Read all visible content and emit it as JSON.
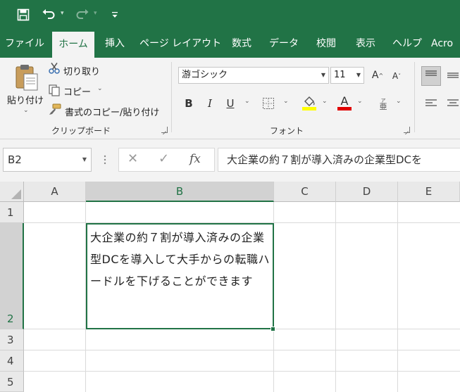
{
  "qat": {
    "save_icon": "save-icon",
    "undo_icon": "undo-icon",
    "redo_icon": "redo-icon",
    "customize_icon": "customize-qat-icon"
  },
  "tabs": [
    {
      "label": "ファイル"
    },
    {
      "label": "ホーム"
    },
    {
      "label": "挿入"
    },
    {
      "label": "ページ レイアウト"
    },
    {
      "label": "数式"
    },
    {
      "label": "データ"
    },
    {
      "label": "校閲"
    },
    {
      "label": "表示"
    },
    {
      "label": "ヘルプ"
    },
    {
      "label": "Acro"
    }
  ],
  "active_tab": "ホーム",
  "clipboard": {
    "paste_label": "貼り付け",
    "cut_label": "切り取り",
    "copy_label": "コピー",
    "format_painter_label": "書式のコピー/貼り付け",
    "group_label": "クリップボード"
  },
  "font": {
    "font_name": "游ゴシック",
    "font_size": "11",
    "bold": "B",
    "italic": "I",
    "underline": "U",
    "group_label": "フォント"
  },
  "colors": {
    "brand": "#217346",
    "highlight": "#ffff00",
    "font_color": "#e00000"
  },
  "formula_bar": {
    "name_box": "B2",
    "cancel_glyph": "✕",
    "enter_glyph": "✓",
    "fx_glyph": "fx",
    "content": "大企業の約７割が導入済みの企業型DCを"
  },
  "sheet": {
    "columns": [
      "A",
      "B",
      "C",
      "D",
      "E"
    ],
    "rows": [
      "1",
      "2",
      "3",
      "4",
      "5"
    ],
    "selected_cell": "B2",
    "b2_text": "大企業の約７割が導入済みの企業型DCを導入して大手からの転職ハードルを下げることができます"
  }
}
